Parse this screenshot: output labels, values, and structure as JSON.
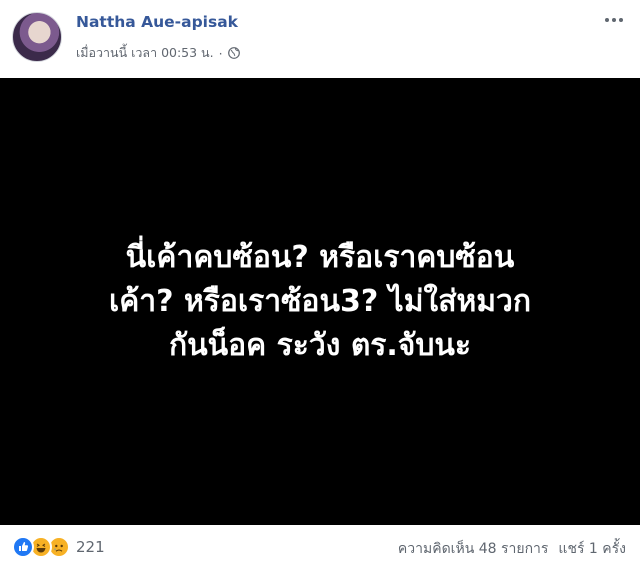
{
  "post": {
    "author": "Nattha Aue-apisak",
    "timestamp": "เมื่อวานนี้ เวลา 00:53 น.",
    "separator": "·",
    "privacy_icon": "globe-icon",
    "more_icon": "more-options-icon",
    "image_text_lines": [
      "นี่เค้าคบซ้อน? หรือเราคบซ้อน",
      "เค้า? หรือเราซ้อน3? ไม่ใส่หมวก",
      "กันน็อค ระวัง ตร.จับนะ"
    ],
    "image_background": "#000000"
  },
  "footer": {
    "reaction_icons": [
      "like-icon",
      "haha-icon",
      "sad-icon"
    ],
    "reaction_count": "221",
    "comments": "ความคิดเห็น 48 รายการ",
    "shares": "แชร์ 1 ครั้ง"
  },
  "colors": {
    "author": "#365899",
    "meta": "#616770",
    "like": "#2078f4",
    "emoji": "#f7b125"
  }
}
